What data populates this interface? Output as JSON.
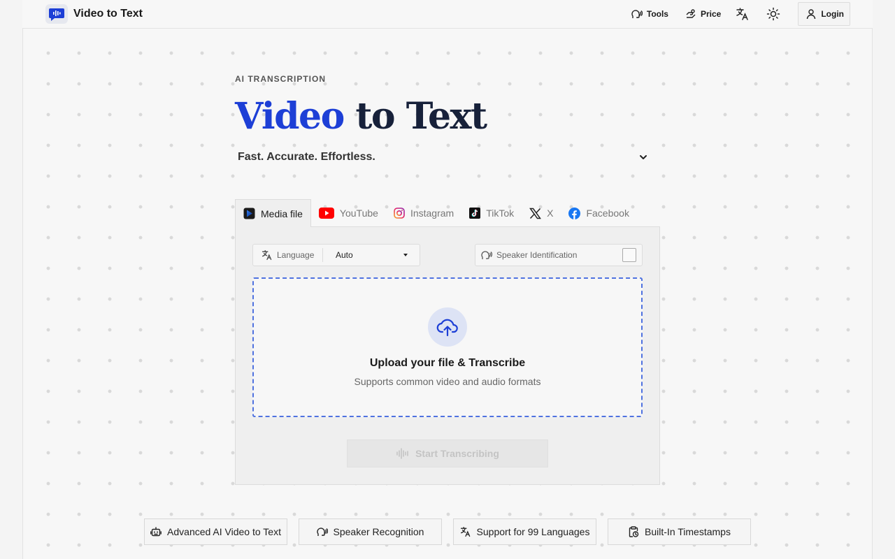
{
  "header": {
    "brand": "Video to Text",
    "nav": [
      {
        "label": "Tools",
        "icon": "speaker-head-icon"
      },
      {
        "label": "Price",
        "icon": "coins-icon"
      }
    ],
    "language_icon": "translate-icon",
    "theme_icon": "sun-icon",
    "login_label": "Login"
  },
  "hero": {
    "eyebrow": "AI TRANSCRIPTION",
    "title_accent": "Video",
    "title_rest": " to Text",
    "subtitle": "Fast. Accurate. Effortless."
  },
  "tabs": [
    {
      "label": "Media file",
      "active": true
    },
    {
      "label": "YouTube"
    },
    {
      "label": "Instagram"
    },
    {
      "label": "TikTok"
    },
    {
      "label": "X"
    },
    {
      "label": "Facebook"
    }
  ],
  "panel": {
    "language_label": "Language",
    "language_value": "Auto",
    "speaker_label": "Speaker Identification",
    "speaker_checked": false,
    "upload_title": "Upload your file & Transcribe",
    "upload_sub": "Supports common video and audio formats",
    "start_label": "Start Transcribing"
  },
  "features": [
    {
      "label": "Advanced AI Video to Text",
      "icon": "robot-icon"
    },
    {
      "label": "Speaker Recognition",
      "icon": "speaker-head-icon"
    },
    {
      "label": "Support for 99 Languages",
      "icon": "translate-icon"
    },
    {
      "label": "Built-In Timestamps",
      "icon": "clipboard-clock-icon"
    }
  ],
  "colors": {
    "accent": "#1d3fd6",
    "dropzone_border": "#4f72e0",
    "youtube": "#ff0000",
    "facebook": "#1877f2"
  }
}
